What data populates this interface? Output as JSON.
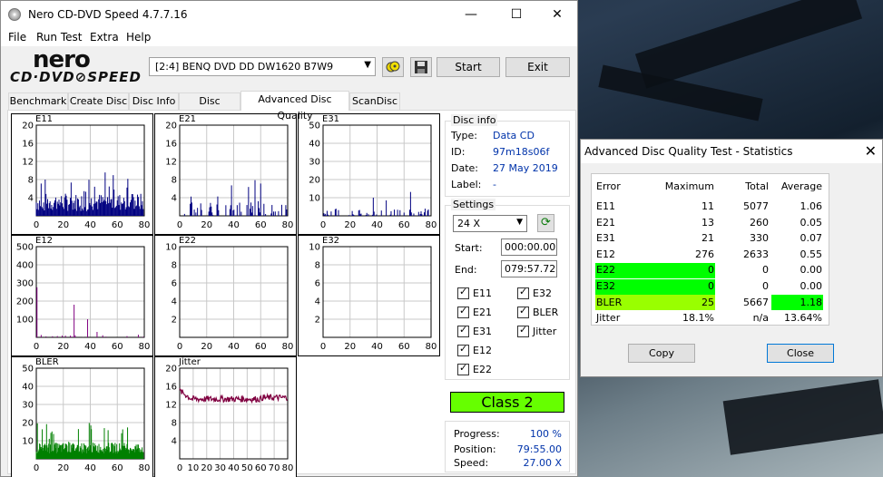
{
  "main_window": {
    "title": "Nero CD-DVD Speed 4.7.7.16",
    "minimize": "—",
    "maximize": "☐",
    "close": "✕"
  },
  "menu": [
    "File",
    "Run Test",
    "Extra",
    "Help"
  ],
  "logo": {
    "nero": "nero",
    "cddvd": "CD·DVD⊘SPEED"
  },
  "toolbar": {
    "drive": "[2:4]   BENQ DVD DD DW1620 B7W9",
    "start": "Start",
    "exit": "Exit"
  },
  "tabs": [
    "Benchmark",
    "Create Disc",
    "Disc Info",
    "Disc Quality",
    "Advanced Disc Quality",
    "ScanDisc"
  ],
  "active_tab": 4,
  "graphs": [
    {
      "name": "E11",
      "ymax": 20,
      "yticks": [
        20,
        16,
        12,
        8,
        4
      ],
      "xticks": [
        0,
        20,
        40,
        60,
        80
      ],
      "color": "#000080"
    },
    {
      "name": "E21",
      "ymax": 20,
      "yticks": [
        20,
        16,
        12,
        8,
        4
      ],
      "xticks": [
        0,
        20,
        40,
        60,
        80
      ],
      "color": "#000080"
    },
    {
      "name": "E31",
      "ymax": 50,
      "yticks": [
        50,
        40,
        30,
        20,
        10
      ],
      "xticks": [
        0,
        20,
        40,
        60,
        80
      ],
      "color": "#000080"
    },
    {
      "name": "E12",
      "ymax": 500,
      "yticks": [
        500,
        400,
        300,
        200,
        100
      ],
      "xticks": [
        0,
        20,
        40,
        60,
        80
      ],
      "color": "#800080"
    },
    {
      "name": "E22",
      "ymax": 10,
      "yticks": [
        10,
        8,
        6,
        4,
        2
      ],
      "xticks": [
        0,
        20,
        40,
        60,
        80
      ],
      "color": "#800080"
    },
    {
      "name": "E32",
      "ymax": 10,
      "yticks": [
        10,
        8,
        6,
        4,
        2
      ],
      "xticks": [
        0,
        20,
        40,
        60,
        80
      ],
      "color": "#800080"
    },
    {
      "name": "BLER",
      "ymax": 50,
      "yticks": [
        50,
        40,
        30,
        20,
        10
      ],
      "xticks": [
        0,
        20,
        40,
        60,
        80
      ],
      "color": "#008000"
    },
    {
      "name": "Jitter",
      "ymax": 20,
      "yticks": [
        20,
        16,
        12,
        8,
        4
      ],
      "xticks": [
        0,
        10,
        20,
        30,
        40,
        50,
        60,
        70,
        80
      ],
      "color": "#800040"
    }
  ],
  "disc_info": {
    "legend": "Disc info",
    "type_label": "Type:",
    "type": "Data CD",
    "id_label": "ID:",
    "id": "97m18s06f",
    "date_label": "Date:",
    "date": "27 May 2019",
    "label_label": "Label:",
    "label": "-"
  },
  "settings": {
    "legend": "Settings",
    "speed": "24 X",
    "start_label": "Start:",
    "start": "000:00.00",
    "end_label": "End:",
    "end": "079:57.72",
    "checks_left": [
      "E11",
      "E21",
      "E31",
      "E12",
      "E22"
    ],
    "checks_right": [
      "E32",
      "BLER",
      "Jitter"
    ]
  },
  "class_label": "Class 2",
  "progress": {
    "progress_label": "Progress:",
    "progress": "100 %",
    "position_label": "Position:",
    "position": "79:55.00",
    "speed_label": "Speed:",
    "speed": "27.00 X"
  },
  "stats": {
    "title": "Advanced Disc Quality Test - Statistics",
    "close": "✕",
    "headers": [
      "Error",
      "Maximum",
      "Total",
      "Average"
    ],
    "rows": [
      {
        "error": "E11",
        "max": "11",
        "total": "5077",
        "avg": "1.06"
      },
      {
        "error": "E21",
        "max": "13",
        "total": "260",
        "avg": "0.05"
      },
      {
        "error": "E31",
        "max": "21",
        "total": "330",
        "avg": "0.07"
      },
      {
        "error": "E12",
        "max": "276",
        "total": "2633",
        "avg": "0.55"
      },
      {
        "error": "E22",
        "max": "0",
        "total": "0",
        "avg": "0.00"
      },
      {
        "error": "E32",
        "max": "0",
        "total": "0",
        "avg": "0.00"
      },
      {
        "error": "BLER",
        "max": "25",
        "total": "5667",
        "avg": "1.18"
      },
      {
        "error": "Jitter",
        "max": "18.1%",
        "total": "n/a",
        "avg": "13.64%"
      }
    ],
    "copy": "Copy",
    "close_btn": "Close",
    "highlight_green": "#00ff00",
    "highlight_yellowgreen": "#99ff00"
  }
}
